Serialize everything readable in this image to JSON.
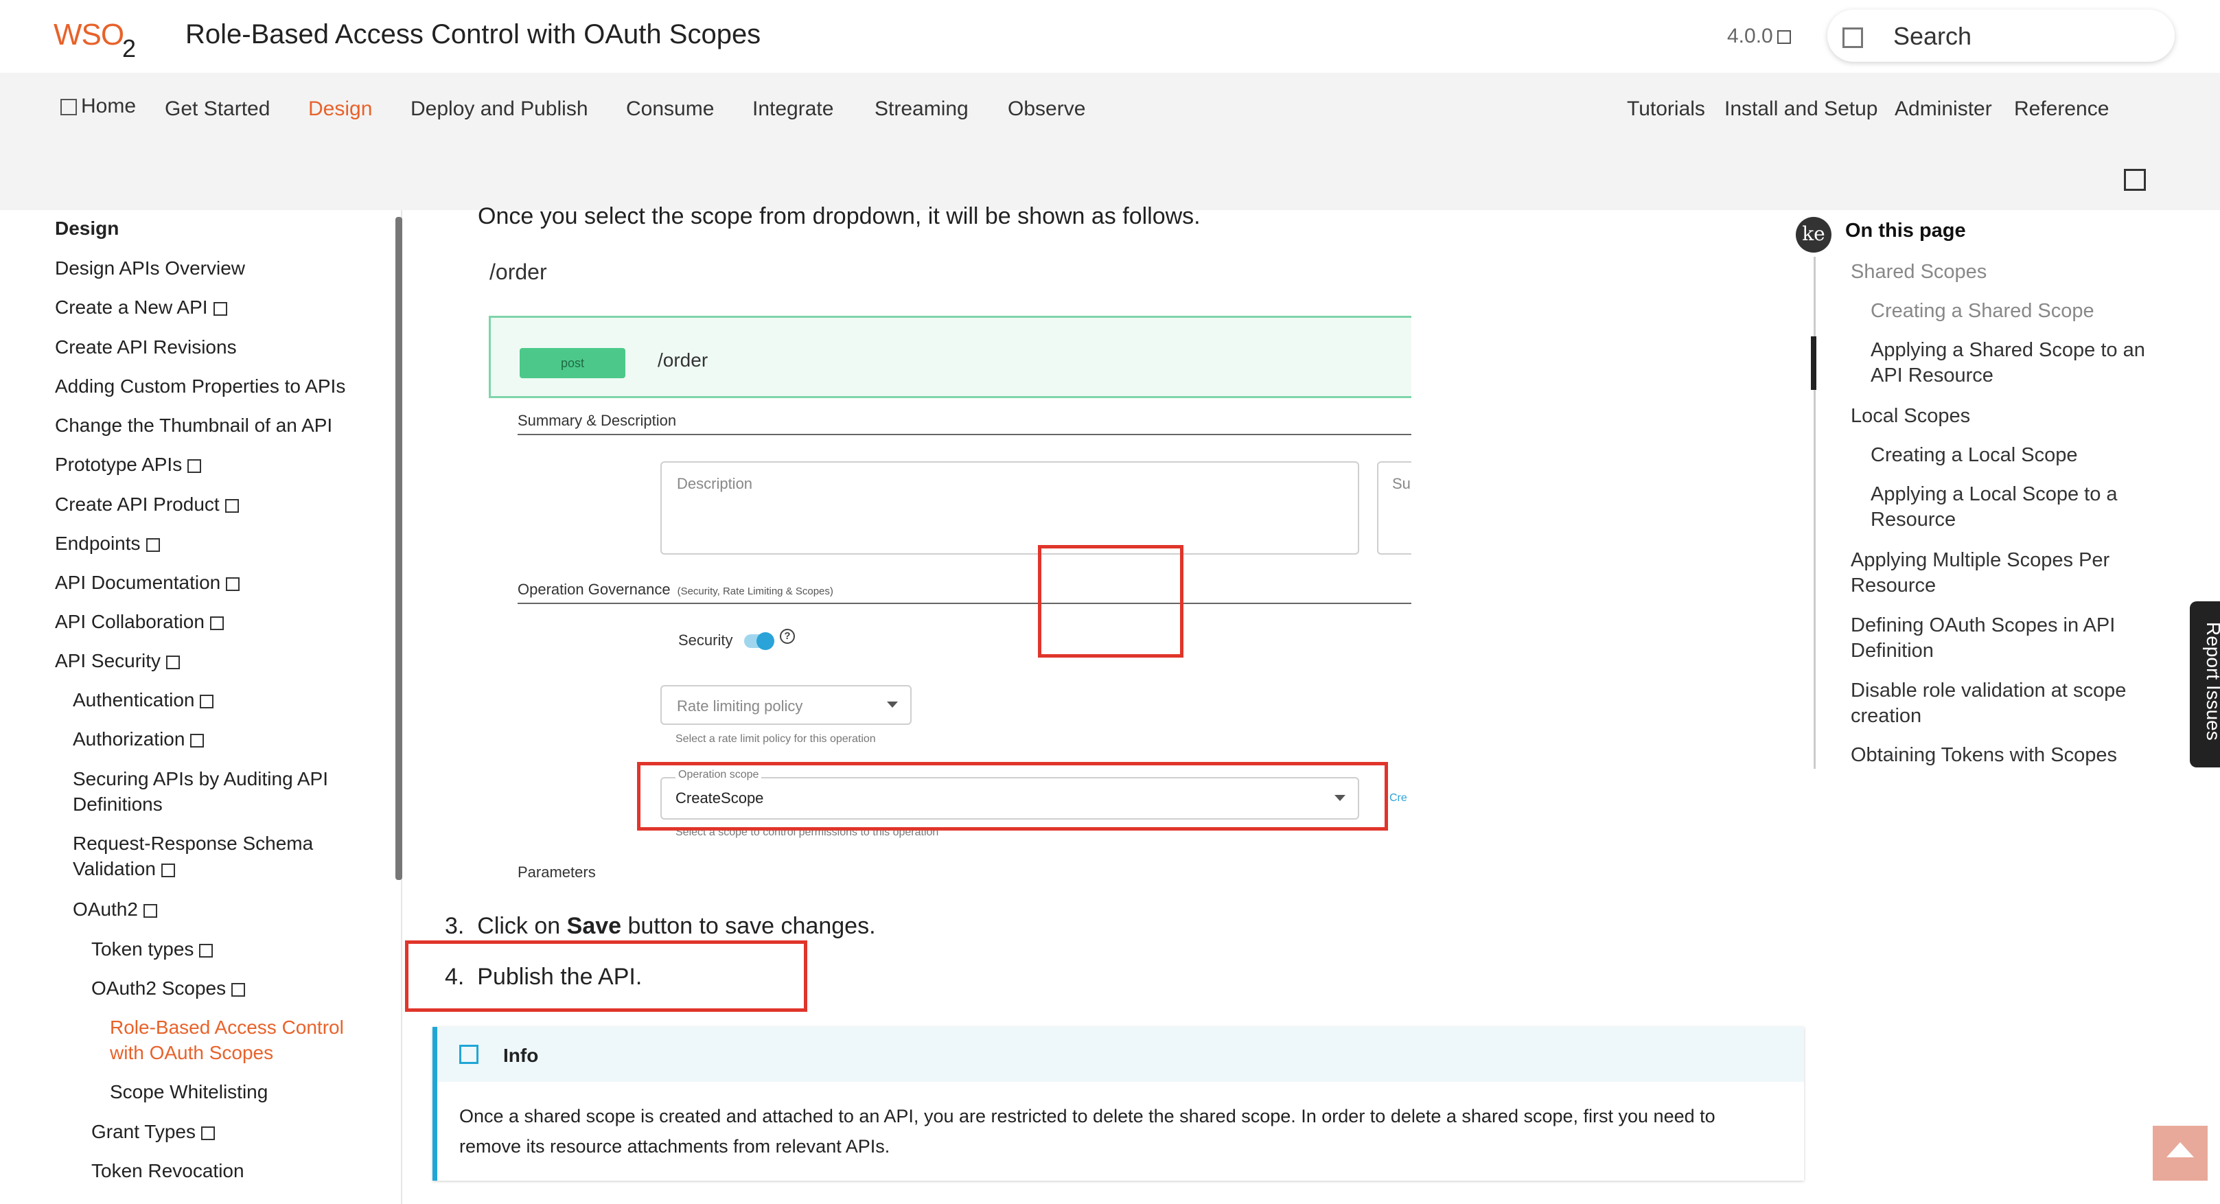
{
  "header": {
    "logo_text": "WSO",
    "logo_sub": "2",
    "title": "Role-Based Access Control with OAuth Scopes",
    "version": "4.0.0",
    "search_label": "Search"
  },
  "nav": {
    "left": [
      "Home",
      "Get Started",
      "Design",
      "Deploy and Publish",
      "Consume",
      "Integrate",
      "Streaming",
      "Observe"
    ],
    "right": [
      "Tutorials",
      "Install and Setup",
      "Administer",
      "Reference"
    ],
    "active": "Design"
  },
  "sidebar": {
    "items": [
      {
        "label": "Design"
      },
      {
        "label": "Design APIs Overview"
      },
      {
        "label": "Create a New API"
      },
      {
        "label": "Create API Revisions"
      },
      {
        "label": "Adding Custom Properties to APIs"
      },
      {
        "label": "Change the Thumbnail of an API"
      },
      {
        "label": "Prototype APIs"
      },
      {
        "label": "Create API Product"
      },
      {
        "label": "Endpoints"
      },
      {
        "label": "API Documentation"
      },
      {
        "label": "API Collaboration"
      },
      {
        "label": "API Security"
      },
      {
        "label": "Authentication"
      },
      {
        "label": "Authorization"
      },
      {
        "label": "Securing APIs by Auditing API",
        "label2": "Definitions"
      },
      {
        "label": "Request-Response Schema",
        "label2": "Validation"
      },
      {
        "label": "OAuth2"
      },
      {
        "label": "Token types"
      },
      {
        "label": "OAuth2 Scopes"
      },
      {
        "label": "Role-Based Access Control",
        "label2": "with OAuth Scopes"
      },
      {
        "label": "Scope Whitelisting"
      },
      {
        "label": "Grant Types"
      },
      {
        "label": "Token Revocation"
      }
    ]
  },
  "content": {
    "intro": "Once you select the scope from dropdown, it will be shown as follows.",
    "path": "/order",
    "step3_num": "3.",
    "step3_pre": "Click on ",
    "step3_bold": "Save",
    "step3_post": " button to save changes.",
    "step4_num": "4.",
    "step4_text": "Publish the API.",
    "info_title": "Info",
    "info_body": "Once a shared scope is created and attached to an API, you are restricted to delete the shared scope. In order to delete a shared scope, first you need to remove its resource attachments from relevant APIs."
  },
  "screenshot": {
    "method": "post",
    "path": "/order",
    "summary_label": "Summary & Description",
    "description_placeholder": "Description",
    "summary_placeholder": "Su",
    "governance_label": "Operation Governance",
    "governance_sub": "(Security, Rate Limiting & Scopes)",
    "security_label": "Security",
    "help_glyph": "?",
    "rate_limit_placeholder": "Rate limiting policy",
    "rate_limit_hint": "Select a rate limit policy for this operation",
    "scope_label": "Operation scope",
    "scope_value": "CreateScope",
    "scope_hint": "Select a scope to control permissions to this operation",
    "create_link": "Cre",
    "parameters_label": "Parameters"
  },
  "toc": {
    "icon_text": "ke",
    "title": "On this page",
    "items": [
      {
        "label": "Shared Scopes"
      },
      {
        "label": "Creating a Shared Scope"
      },
      {
        "label": "Applying a Shared Scope to an",
        "label2": "API Resource"
      },
      {
        "label": "Local Scopes"
      },
      {
        "label": "Creating a Local Scope"
      },
      {
        "label": "Applying a Local Scope to a",
        "label2": "Resource"
      },
      {
        "label": "Applying Multiple Scopes Per",
        "label2": "Resource"
      },
      {
        "label": "Defining OAuth Scopes in API",
        "label2": "Definition"
      },
      {
        "label": "Disable role validation at scope",
        "label2": "creation"
      },
      {
        "label": "Obtaining Tokens with Scopes"
      }
    ]
  },
  "report_issues": "Report Issues",
  "colors": {
    "accent": "#e8622a",
    "info": "#20a6d6",
    "highlight": "#e0352b",
    "post": "#4cc98a"
  }
}
